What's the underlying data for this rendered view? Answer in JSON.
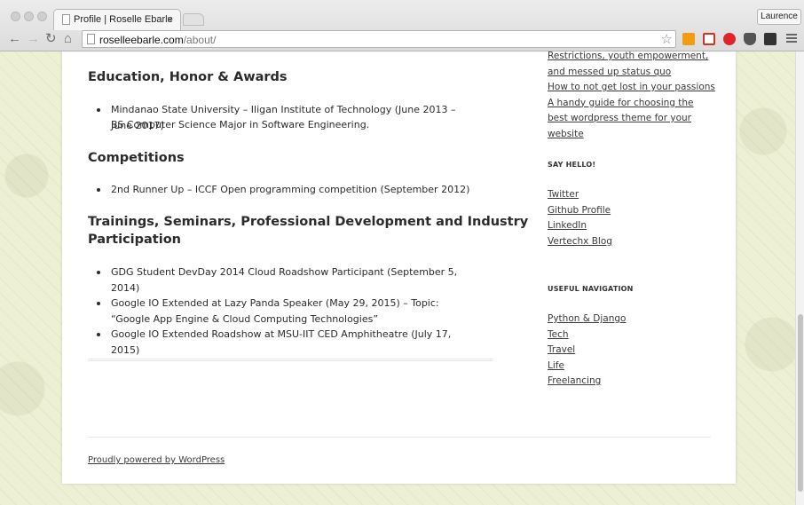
{
  "browser": {
    "tab_title": "Profile | Roselle Ebarle",
    "tab_close": "×",
    "profile_name": "Laurence",
    "url_host": "roselleebarle.com",
    "url_path": "/about/",
    "icons": [
      "back-arrow-icon",
      "forward-arrow-icon",
      "reload-icon",
      "home-icon",
      "bookmark-star-icon",
      "menu-icon"
    ],
    "extensions": [
      {
        "name": "analytics-extension-icon",
        "color": "#f39c12"
      },
      {
        "name": "gmail-extension-icon",
        "color": "#d93025"
      },
      {
        "name": "opera-extension-icon",
        "color": "#e0242b"
      },
      {
        "name": "pocket-extension-icon",
        "color": "#444444"
      },
      {
        "name": "medium-extension-icon",
        "color": "#333333"
      }
    ]
  },
  "content": {
    "education": {
      "title": "Education, Honor & Awards",
      "items": [
        "Mindanao State University – Iligan Institute of Technology (June 2013 – June 2017)"
      ],
      "subline": "BS Computer Science Major in Software Engineering."
    },
    "competitions": {
      "title": "Competitions",
      "items": [
        "2nd Runner Up – ICCF Open programming competition (September 2012)"
      ]
    },
    "trainings": {
      "title_line1": "Trainings, Seminars, Professional Development and Industry",
      "title_line2": "Participation",
      "items": [
        "GDG Student DevDay 2014 Cloud Roadshow Participant (September 5, 2014)",
        "Google IO Extended at Lazy Panda Speaker (May 29, 2015) – Topic: “Google App Engine & Cloud Computing Technologies”",
        "Google IO Extended Roadshow at MSU-IIT CED Amphitheatre (July 17, 2015)"
      ]
    }
  },
  "sidebar": {
    "recent_posts": [
      "Restrictions, youth empowerment, and messed up status quo",
      "How to not get lost in your passions",
      "A handy guide for choosing the best wordpress theme for your website"
    ],
    "say_hello": {
      "title": "SAY HELLO!",
      "links": [
        "Twitter",
        "Github Profile",
        "LinkedIn",
        "Vertechx Blog"
      ]
    },
    "navigation": {
      "title": "USEFUL NAVIGATION",
      "links": [
        "Python & Django",
        "Tech",
        "Travel",
        "Life",
        "Freelancing"
      ]
    }
  },
  "footer": {
    "credit": "Proudly powered by WordPress"
  }
}
